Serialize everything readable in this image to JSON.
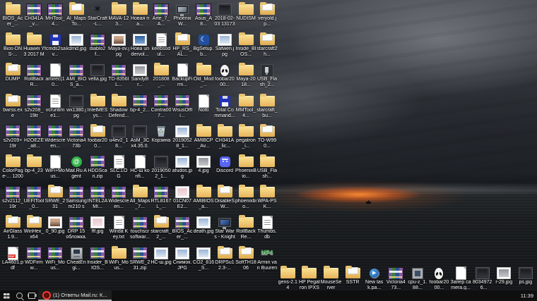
{
  "colors": {
    "taskbar_bg": "#101010",
    "sunset_glow": "#ff8a2e",
    "folder_yellow": "#e7b35a",
    "task_underline": "#bcbcbc"
  },
  "desktop": {
    "rows": [
      {
        "cells": [
          {
            "t": "folder",
            "l": "BIOS_Acer_..."
          },
          {
            "t": "rar",
            "l": "CH341A_v..."
          },
          {
            "t": "rar",
            "l": "MHTool_4..."
          },
          {
            "t": "folder2",
            "l": "AI_MapsTo..."
          },
          {
            "t": "star",
            "l": "StarCraft-L..."
          },
          {
            "t": "folder",
            "l": "MAVA-123..."
          },
          {
            "t": "folder",
            "l": "Новая па..."
          },
          {
            "t": "rar",
            "l": "Arte_7_A..."
          },
          {
            "t": "screen",
            "l": "PhoenixW..."
          },
          {
            "t": "rar",
            "l": "Asus_A8..."
          },
          {
            "t": "imgdark",
            "l": "2018-02-03 131736(2)"
          },
          {
            "t": "folder",
            "l": "NUDISM"
          },
          {
            "t": "folder2",
            "l": "veryold.jp..."
          }
        ]
      },
      {
        "cells": [
          {
            "t": "folder",
            "l": "Bios-DNS-..."
          },
          {
            "t": "folder",
            "l": "Huawei Y3 2017 Maya..."
          },
          {
            "t": "floppy",
            "l": "fcmds2sav..."
          },
          {
            "t": "img",
            "l": "kdmd.jpg"
          },
          {
            "t": "rar",
            "l": "diablo2 f..."
          },
          {
            "t": "photo",
            "l": "Maya-ov.jpg"
          },
          {
            "t": "imglaptop",
            "l": "Нова undervol..."
          },
          {
            "t": "filegray",
            "l": "keebsodul..."
          },
          {
            "t": "folder2",
            "l": "HP_RS_AL..."
          },
          {
            "t": "moon",
            "l": "BgSetup.b..."
          },
          {
            "t": "img",
            "l": "Safwen.jpg"
          },
          {
            "t": "folder",
            "l": "Inside_BIOS..."
          },
          {
            "t": "folder2",
            "l": "starcraft2 h..."
          }
        ]
      },
      {
        "cells": [
          {
            "t": "folder2",
            "l": "DUMP"
          },
          {
            "t": "rar",
            "l": "RollBackR..."
          },
          {
            "t": "file",
            "l": "amirec(10..."
          },
          {
            "t": "rar",
            "l": "AMI_BIOS_a..."
          },
          {
            "t": "imgdark",
            "l": "velta.jpg"
          },
          {
            "t": "rar",
            "l": "TD-8356IL..."
          },
          {
            "t": "imggray",
            "l": "SandyBr..."
          },
          {
            "t": "folder",
            "l": "201808_..."
          },
          {
            "t": "file",
            "l": "BackupFirm..."
          },
          {
            "t": "folder",
            "l": "Old_Mod_..."
          },
          {
            "t": "alien",
            "l": "foobar2000..."
          },
          {
            "t": "folder",
            "l": "Maya-2018..."
          },
          {
            "t": "usb",
            "l": "USB_Flash_2..."
          }
        ]
      },
      {
        "cells": [
          {
            "t": "folder2",
            "l": "bwrss.exe"
          },
          {
            "t": "rar",
            "l": "s2v208_19tr"
          },
          {
            "t": "filegray",
            "l": "vcruntime1..."
          },
          {
            "t": "imgdark",
            "l": "wx1380.jpg"
          },
          {
            "t": "folder",
            "l": "IntelMESys..."
          },
          {
            "t": "folder",
            "l": "Shadow Defend..."
          },
          {
            "t": "rar",
            "l": "bp-4_2..."
          },
          {
            "t": "rar",
            "l": "Contra007..."
          },
          {
            "t": "rar",
            "l": "WsusOffli..."
          },
          {
            "t": "file",
            "l": "Notti"
          },
          {
            "t": "floppy",
            "l": "Total Command..."
          },
          {
            "t": "folder",
            "l": "MMTool_4..."
          },
          {
            "t": "folder",
            "l": "starcraft_bu..."
          }
        ]
      },
      {
        "cells": [
          {
            "t": "rar",
            "l": "s2v209+19r"
          },
          {
            "t": "rar",
            "l": "H2OEZE_a8..."
          },
          {
            "t": "rar",
            "l": "Widescreen..."
          },
          {
            "t": "rar",
            "l": "Victoria473b"
          },
          {
            "t": "folder2",
            "l": "foobar200..."
          },
          {
            "t": "imgdark",
            "l": "u4ev2_18..."
          },
          {
            "t": "imgdark",
            "l": "AsM_3C x4.35.0.0..."
          },
          {
            "t": "bin",
            "l": "Корзина"
          },
          {
            "t": "img",
            "l": "20190528_1..."
          },
          {
            "t": "folder",
            "l": "AMIBCP_Av..."
          },
          {
            "t": "folder",
            "l": "CH341A_lic..."
          },
          {
            "t": "folder",
            "l": "pegatron_i..."
          },
          {
            "t": "folder2",
            "l": "TO-W990..."
          }
        ]
      },
      {
        "cells": [
          {
            "t": "folder",
            "l": "ColorPage-... 1200XE"
          },
          {
            "t": "folder",
            "l": "bp-4_23"
          },
          {
            "t": "file",
            "l": "WiFi+Mous..."
          },
          {
            "t": "mail",
            "l": "Mail.Ru Agent"
          },
          {
            "t": "rar",
            "l": "HDDScan.zip"
          },
          {
            "t": "filegray",
            "l": "SLC.LOG"
          },
          {
            "t": "file",
            "l": "HC-ш konfi..."
          },
          {
            "t": "imgdark",
            "l": "20190502_1..."
          },
          {
            "t": "img",
            "l": "afudos.jpg"
          },
          {
            "t": "imggray",
            "l": "4.jpg"
          },
          {
            "t": "discord",
            "l": "Discord"
          },
          {
            "t": "folder",
            "l": "PhoenixBio..."
          },
          {
            "t": "folder",
            "l": "USB_Flash..."
          }
        ]
      },
      {
        "cells": [
          {
            "t": "rar",
            "l": "s2v2112_19r"
          },
          {
            "t": "rar",
            "l": "UEFITool_0..."
          },
          {
            "t": "folder2",
            "l": "SRWE_231"
          },
          {
            "t": "rar",
            "l": "Samsung m210 se..."
          },
          {
            "t": "rar",
            "l": "INTEL2AMI..."
          },
          {
            "t": "rar",
            "l": "Widescreen..."
          },
          {
            "t": "folder",
            "l": "All_Maps_7..."
          },
          {
            "t": "rar",
            "l": "RTL8167L_..."
          },
          {
            "t": "imgpink",
            "l": "01CN07E2..."
          },
          {
            "t": "folder",
            "l": "AMIBIOS_a..."
          },
          {
            "t": "folder2",
            "l": "DisableSW..."
          },
          {
            "t": "folder",
            "l": "phoenixbio..."
          },
          {
            "t": "folder",
            "l": "WPA-PSK..."
          }
        ]
      },
      {
        "cells": [
          {
            "t": "folder2",
            "l": "AirGlass1.9..."
          },
          {
            "t": "folder2",
            "l": "WinHex_x64"
          },
          {
            "t": "photo",
            "l": "0_90.jpg"
          },
          {
            "t": "rar",
            "l": "DRP 15 обложка.xм"
          },
          {
            "t": "imgpink",
            "l": "fff.jpg"
          },
          {
            "t": "filegray",
            "l": "Winda Key.txt"
          },
          {
            "t": "rar",
            "l": "touchscr softwar..."
          },
          {
            "t": "folder2",
            "l": "starcraft_2_..."
          },
          {
            "t": "rar",
            "l": "BIOS_Acer_..."
          },
          {
            "t": "img",
            "l": "death.jpg"
          },
          {
            "t": "screen2",
            "l": "Star Wars - Knights ..."
          },
          {
            "t": "folder",
            "l": "RollBackRe..."
          },
          {
            "t": "filegray",
            "l": "Thumbs.db"
          }
        ]
      },
      {
        "cells": [
          {
            "t": "pdf",
            "l": "LA4601.pdf"
          },
          {
            "t": "rar",
            "l": "WDFirmw..."
          },
          {
            "t": "rar",
            "l": "WiFi_Mous..."
          },
          {
            "t": "cheat",
            "l": "CheatEngi..."
          },
          {
            "t": "rar",
            "l": "Insider_BIOS..."
          },
          {
            "t": "folder",
            "l": "WiFi_Mous..."
          },
          {
            "t": "rar",
            "l": "SRWE_231.zip"
          },
          {
            "t": "img",
            "l": "HC-ш.jpg"
          },
          {
            "t": "img",
            "l": "Снимок.JPG"
          },
          {
            "t": "img",
            "l": "CO2_816_S..."
          },
          {
            "t": "folder2",
            "l": "DRPSu12.3-..."
          },
          {
            "t": "folder2",
            "l": "SoftTH1806"
          },
          {
            "t": "mp4",
            "l": "Armin van Buuren fe..."
          }
        ]
      }
    ],
    "bottom_row": [
      {
        "t": "folder",
        "l": "gens-2.14"
      },
      {
        "t": "folder",
        "l": "HP Pegatron IPXSB-DM..."
      },
      {
        "t": "folder",
        "l": "MouseServer"
      },
      {
        "t": "folder2",
        "l": "SSTR"
      },
      {
        "t": "play",
        "l": "New task.pa..."
      },
      {
        "t": "rar",
        "l": "Victoria473..."
      },
      {
        "t": "cpu",
        "l": "cpu-z_1.88..."
      },
      {
        "t": "alien",
        "l": "foobar2000..."
      },
      {
        "t": "file",
        "l": "Запер camera.g..."
      },
      {
        "t": "imgdark",
        "l": "8034972_6..."
      },
      {
        "t": "imggray",
        "l": "r-29.jpg"
      },
      {
        "t": "imgdark",
        "l": "ps.jpg"
      }
    ]
  },
  "taskbar": {
    "task": {
      "label": "(1) Ответы Mail.ru: К..."
    },
    "clock": "11:39"
  }
}
